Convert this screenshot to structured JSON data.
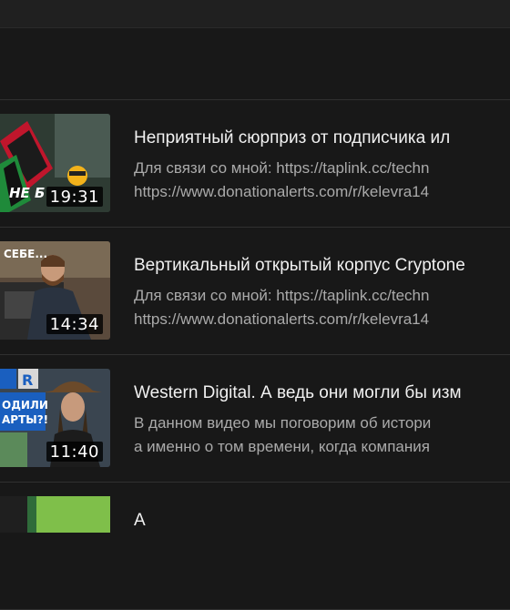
{
  "videos": [
    {
      "title": "Неприятный сюрприз от подписчика ил",
      "duration": "19:31",
      "thumb_text": "НЕ Б",
      "desc_line1": "Для связи со мной: https://taplink.cc/techn",
      "desc_line2": "https://www.donationalerts.com/r/kelevra14"
    },
    {
      "title": "Вертикальный открытый корпус Cryptone",
      "duration": "14:34",
      "thumb_text": "СЕБЕ...",
      "desc_line1": "Для связи со мной: https://taplink.cc/techn",
      "desc_line2": "https://www.donationalerts.com/r/kelevra14"
    },
    {
      "title": "Western Digital. А ведь они могли бы изм",
      "duration": "11:40",
      "thumb_text_1": "ОДИЛИ",
      "thumb_text_2": "АРТЫ?!",
      "desc_line1": "В данном видео мы поговорим об истори",
      "desc_line2": "а именно о том времени, когда компания"
    }
  ],
  "partial_title": "А"
}
